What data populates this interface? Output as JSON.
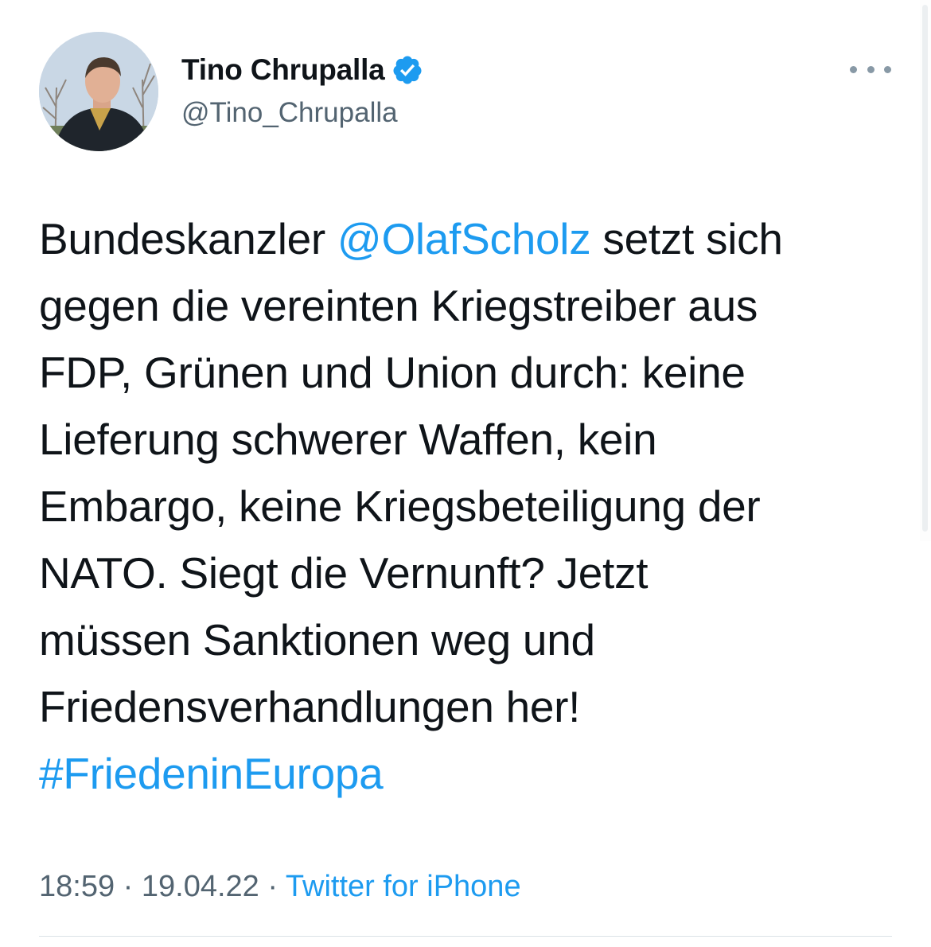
{
  "tweet": {
    "author": {
      "display_name": "Tino Chrupalla",
      "handle": "@Tino_Chrupalla",
      "verified": true,
      "avatar_icon": "user-avatar"
    },
    "more_icon": "more-horizontal-icon",
    "text_lines": [
      [
        {
          "text": "Bundeskanzler ",
          "type": "text"
        },
        {
          "text": "@OlafScholz",
          "type": "mention"
        },
        {
          "text": " setzt sich",
          "type": "text"
        }
      ],
      [
        {
          "text": "gegen die vereinten Kriegstreiber aus",
          "type": "text"
        }
      ],
      [
        {
          "text": "FDP, Grünen und Union durch: keine",
          "type": "text"
        }
      ],
      [
        {
          "text": "Lieferung schwerer Waffen, kein",
          "type": "text"
        }
      ],
      [
        {
          "text": "Embargo, keine Kriegsbeteiligung der",
          "type": "text"
        }
      ],
      [
        {
          "text": "NATO. Siegt die Vernunft? Jetzt",
          "type": "text"
        }
      ],
      [
        {
          "text": "müssen Sanktionen weg und",
          "type": "text"
        }
      ],
      [
        {
          "text": "Friedensverhandlungen her!",
          "type": "text"
        }
      ],
      [
        {
          "text": "#FriedeninEuropa",
          "type": "hashtag"
        }
      ]
    ],
    "meta": {
      "time": "18:59",
      "separator": " · ",
      "date": "19.04.22",
      "source": "Twitter for iPhone"
    }
  },
  "colors": {
    "link": "#1d9bf0",
    "text": "#0f1419",
    "secondary": "#536471",
    "verified_badge": "#1d9bf0"
  }
}
